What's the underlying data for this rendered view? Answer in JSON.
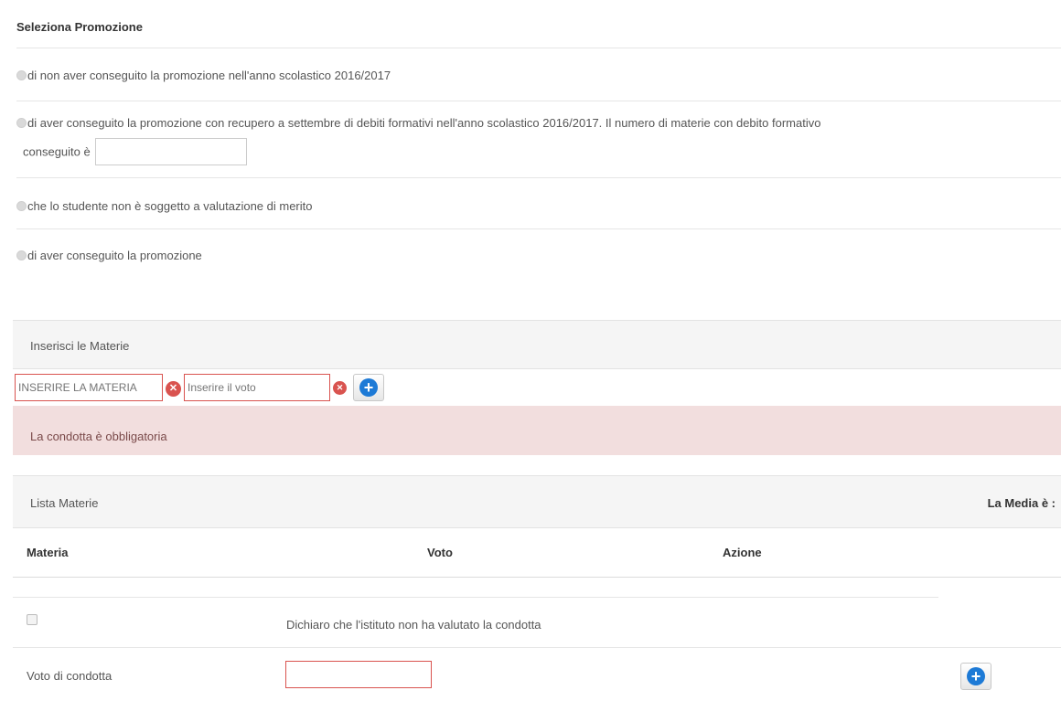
{
  "promozione": {
    "title": "Seleziona Promozione",
    "options": [
      "di non aver conseguito la promozione nell'anno scolastico 2016/2017",
      "di aver conseguito la promozione con recupero a settembre di debiti formativi nell'anno scolastico 2016/2017. Il numero di materie con debito formativo",
      "che lo studente non è soggetto a valutazione di merito",
      "di aver conseguito la promozione"
    ],
    "option2_cont": "conseguito è",
    "debiti_value": ""
  },
  "materie": {
    "header": "Inserisci le Materie",
    "materia_placeholder": "INSERIRE LA MATERIA",
    "voto_placeholder": "Inserire il voto",
    "error_icon": "x-circle-icon",
    "add_icon": "plus-circle-icon"
  },
  "alert": {
    "message": "La condotta è obbligatoria"
  },
  "lista": {
    "header": "Lista Materie",
    "media_label": "La Media è :",
    "columns": [
      "Materia",
      "Voto",
      "Azione"
    ]
  },
  "condotta": {
    "checkbox_label": "Dichiaro che l'istituto non ha valutato la condotta",
    "voto_label": "Voto di condotta",
    "voto_value": ""
  },
  "colors": {
    "error": "#d9534f",
    "alert_bg": "#f2dede",
    "accent": "#1d7ad6",
    "panel_bg": "#f5f5f5"
  }
}
